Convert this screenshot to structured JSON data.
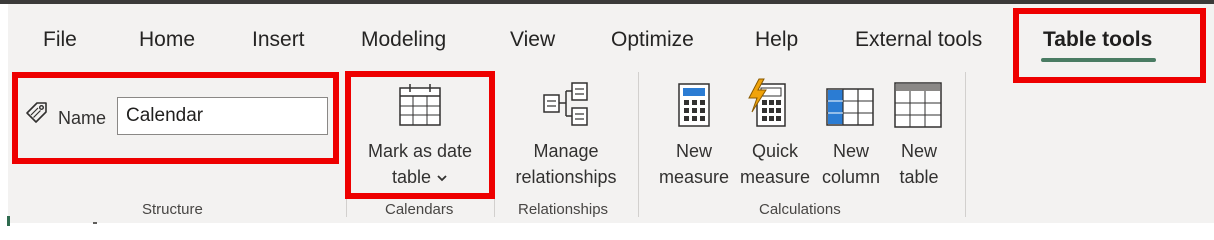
{
  "tabs": [
    {
      "label": "File"
    },
    {
      "label": "Home"
    },
    {
      "label": "Insert"
    },
    {
      "label": "Modeling"
    },
    {
      "label": "View"
    },
    {
      "label": "Optimize"
    },
    {
      "label": "Help"
    },
    {
      "label": "External tools"
    },
    {
      "label": "Table tools",
      "active": true
    }
  ],
  "structure": {
    "name_label": "Name",
    "name_value": "Calendar",
    "group_label": "Structure"
  },
  "calendars": {
    "mark_line1": "Mark as date",
    "mark_line2": "table",
    "group_label": "Calendars"
  },
  "relationships": {
    "manage_line1": "Manage",
    "manage_line2": "relationships",
    "group_label": "Relationships"
  },
  "calculations": {
    "new_measure_line1": "New",
    "new_measure_line2": "measure",
    "quick_measure_line1": "Quick",
    "quick_measure_line2": "measure",
    "new_column_line1": "New",
    "new_column_line2": "column",
    "new_table_line1": "New",
    "new_table_line2": "table",
    "group_label": "Calculations"
  },
  "colors": {
    "accent_underline": "#4a7c63",
    "highlight_box": "#ee0000",
    "ribbon_bg": "#f3f2f1",
    "icon_blue": "#2b7cd3",
    "bolt_orange": "#f0a30a"
  },
  "icons": {
    "name": "tag-icon",
    "mark_as_date_table": "calendar-icon",
    "manage_relationships": "relationships-icon",
    "new_measure": "calculator-icon",
    "quick_measure": "quick-calculator-icon",
    "new_column": "column-icon",
    "new_table": "table-icon",
    "dropdown": "chevron-down-icon"
  }
}
